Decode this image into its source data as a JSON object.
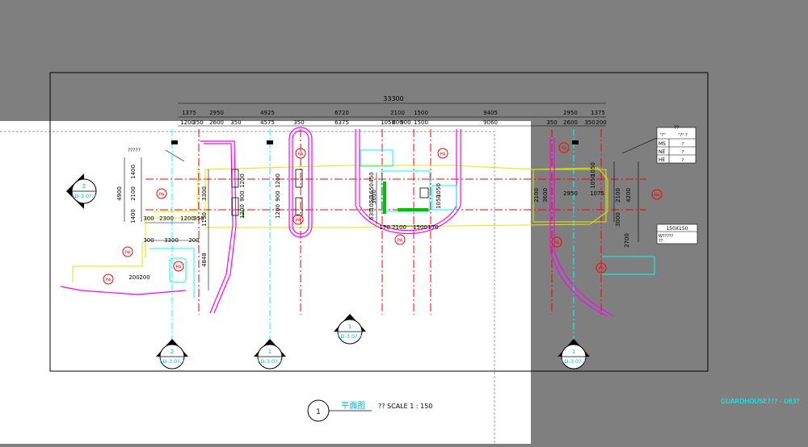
{
  "colors": {
    "paper": "#ffffff",
    "grey": "#7f7f7f",
    "frame": "#000000",
    "axis": "#ff0000",
    "wall": "#ff00ff",
    "cyan": "#00ffff",
    "yellow": "#ffff00",
    "green": "#00c000",
    "dim": "#000000"
  },
  "drawing": {
    "title": "平面图",
    "scale_label": "?? SCALE 1 : 150",
    "title_number": "1",
    "sheet_ref": "GUARDHOUSE??? - 083?",
    "overall_dim": "33300",
    "top_dims_row1": [
      "1375",
      "2950",
      "4925",
      "6720",
      "2100",
      "1500",
      "9405",
      "2950",
      "1375"
    ],
    "top_dims_row2": [
      "1200",
      "350",
      "2600",
      "350",
      "4575",
      "350",
      "6375",
      "1050",
      "800",
      "900",
      "1500",
      "9060",
      "350",
      "2600",
      "350",
      "200"
    ],
    "left_dims": [
      "1400",
      "2100",
      "1400",
      "4900",
      "3300",
      "1150",
      "4848"
    ],
    "lower_left_dims": [
      "300",
      "2300",
      "1200",
      "350",
      "300",
      "3300",
      "200",
      "200",
      "200"
    ],
    "center_dims": [
      "1200",
      "900",
      "1200",
      "1200",
      "900",
      "1200",
      "3600",
      "1050",
      "1650",
      "450",
      "1050",
      "1050",
      "630",
      "170",
      "2100",
      "1500",
      "170"
    ],
    "right_dims": [
      "2950",
      "1075",
      "2100",
      "3600",
      "1050",
      "1050",
      "4200",
      "2100",
      "3000",
      "2700"
    ],
    "pa_markers": [
      "PA",
      "PA",
      "PA",
      "PA",
      "PA",
      "PA",
      "PA",
      "PA",
      "PA",
      "PA",
      "PA",
      "PA"
    ],
    "section_markers": [
      {
        "num": "2",
        "ref": "LD-3.0?.?"
      },
      {
        "num": "2",
        "ref": "LD-3.0?.?"
      },
      {
        "num": "1",
        "ref": "LD-3.0?.?"
      },
      {
        "num": "1",
        "ref": "LD-3.0?.?"
      },
      {
        "num": "1",
        "ref": "LD-3.0?.?"
      }
    ],
    "legend": {
      "title": "??",
      "header": [
        "\"?\"",
        "\"?\" ?"
      ],
      "rows": [
        [
          "MS",
          "?"
        ],
        [
          "NE",
          "?"
        ],
        [
          "HE",
          "?"
        ]
      ]
    },
    "note_box": {
      "size": "150X150",
      "text": "W?????",
      "sub": "??"
    },
    "label_gate": "?????"
  }
}
